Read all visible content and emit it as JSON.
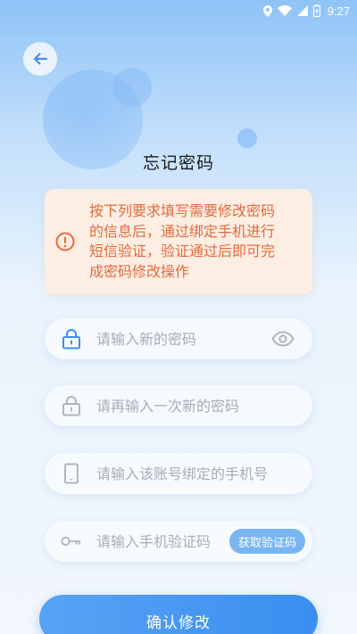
{
  "status_bar": {
    "time": "9:27"
  },
  "page": {
    "title": "忘记密码"
  },
  "notice": {
    "text_lines": [
      "按下列要求填写需要修改密码",
      "的信息后，通过绑定手机进行",
      "短信验证，验证通过后即可完",
      "成密码修改操作"
    ]
  },
  "form": {
    "new_password": {
      "placeholder": "请输入新的密码",
      "value": ""
    },
    "confirm_password": {
      "placeholder": "请再输入一次新的密码",
      "value": ""
    },
    "phone": {
      "placeholder": "请输入该账号绑定的手机号",
      "value": ""
    },
    "sms_code": {
      "placeholder": "请输入手机验证码",
      "value": ""
    },
    "get_code_label": "获取验证码",
    "submit_label": "确认修改"
  },
  "colors": {
    "accent": "#3a8ef0",
    "notice_background": "#fdeee3",
    "notice_text": "#e16a3c",
    "lock_active": "#3e8ef0",
    "icon_muted": "#b0b5bd"
  },
  "icons": {
    "back": "arrow-left-icon",
    "notice": "info-circle-icon",
    "new_password": "lock-icon",
    "confirm_password": "lock-icon",
    "phone": "phone-icon",
    "sms_code": "key-icon",
    "visibility": "eye-icon"
  }
}
